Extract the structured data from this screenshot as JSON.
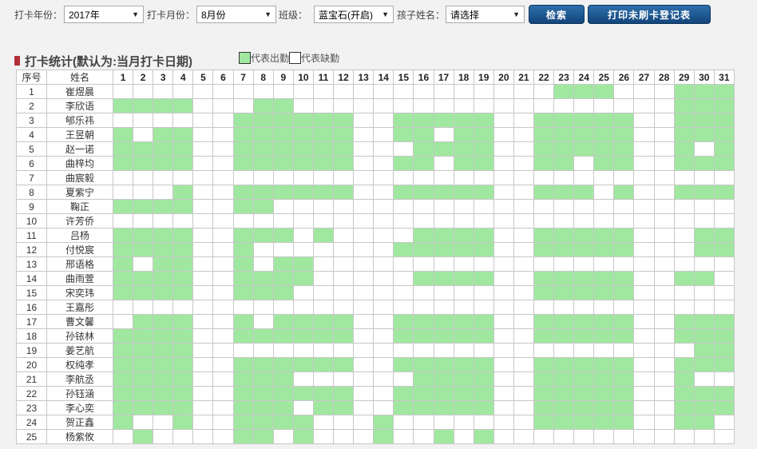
{
  "filters": {
    "year_label": "打卡年份：",
    "year_value": "2017年",
    "month_label": "打卡月份：",
    "month_value": "8月份",
    "class_label": "班级：",
    "class_value": "蓝宝石(开启)",
    "child_label": "孩子姓名：",
    "child_value": "请选择",
    "search_button": "检索",
    "print_button": "打印未刷卡登记表"
  },
  "section": {
    "title": "打卡统计(默认为:当月打卡日期)",
    "legend_present": "代表出勤",
    "legend_absent": "代表缺勤"
  },
  "colors": {
    "present": "#a0e8a0",
    "absent": "#ffffff",
    "button": "#1d568f",
    "title_mark": "#b3303a"
  },
  "table": {
    "header_seq": "序号",
    "header_name": "姓名",
    "days": [
      "1",
      "2",
      "3",
      "4",
      "5",
      "6",
      "7",
      "8",
      "9",
      "10",
      "11",
      "12",
      "13",
      "14",
      "15",
      "16",
      "17",
      "18",
      "19",
      "20",
      "21",
      "22",
      "23",
      "24",
      "25",
      "26",
      "27",
      "28",
      "29",
      "30",
      "31"
    ],
    "rows": [
      {
        "seq": "1",
        "name": "崔煜晨",
        "att": "0000000000000000000000111000111"
      },
      {
        "seq": "2",
        "name": "李欣语",
        "att": "1111000110000000000000000000111"
      },
      {
        "seq": "3",
        "name": "郇乐祎",
        "att": "0000001111110011111001111100111"
      },
      {
        "seq": "4",
        "name": "王昱朝",
        "att": "1011001111110011011001111100111"
      },
      {
        "seq": "5",
        "name": "赵一诺",
        "att": "1111001111110001111001111100101"
      },
      {
        "seq": "6",
        "name": "曲梓均",
        "att": "1111001111110011011001101100111"
      },
      {
        "seq": "7",
        "name": "曲宸毅",
        "att": "0000000000000000000000000000000"
      },
      {
        "seq": "8",
        "name": "夏紫宁",
        "att": "0001001111110011111001110100111"
      },
      {
        "seq": "9",
        "name": "鞠正",
        "att": "1111001100000000000000000000000"
      },
      {
        "seq": "10",
        "name": "许芳侨",
        "att": "0000000000000000000000000000000"
      },
      {
        "seq": "11",
        "name": "吕杨",
        "att": "1111001110100001111001111100011"
      },
      {
        "seq": "12",
        "name": "付悦宸",
        "att": "1111001000000011111001111100011"
      },
      {
        "seq": "13",
        "name": "邢语格",
        "att": "1011001011000000000000000000000"
      },
      {
        "seq": "14",
        "name": "曲雨萱",
        "att": "1111001111000001111001111100110"
      },
      {
        "seq": "15",
        "name": "宋奕玮",
        "att": "1111001110000000000001111100000"
      },
      {
        "seq": "16",
        "name": "王嘉彤",
        "att": "0000000000000000000000000000000"
      },
      {
        "seq": "17",
        "name": "曹文馨",
        "att": "0111001011110011111001111100111"
      },
      {
        "seq": "18",
        "name": "孙铱林",
        "att": "1111001111110011111001111100111"
      },
      {
        "seq": "19",
        "name": "姜艺航",
        "att": "1111000000000000000000000000011"
      },
      {
        "seq": "20",
        "name": "权纯孝",
        "att": "1111001111110011111001111100111"
      },
      {
        "seq": "21",
        "name": "李航丞",
        "att": "1111001110000001111001111100100"
      },
      {
        "seq": "22",
        "name": "孙钰涵",
        "att": "1111001111110011111001111100111"
      },
      {
        "seq": "23",
        "name": "李心奕",
        "att": "1111001110110011111001111100111"
      },
      {
        "seq": "24",
        "name": "贺正鑫",
        "att": "1001001111000100000001111100110"
      },
      {
        "seq": "25",
        "name": "杨紫攸",
        "att": "0100001101000100101000000000000"
      }
    ]
  }
}
